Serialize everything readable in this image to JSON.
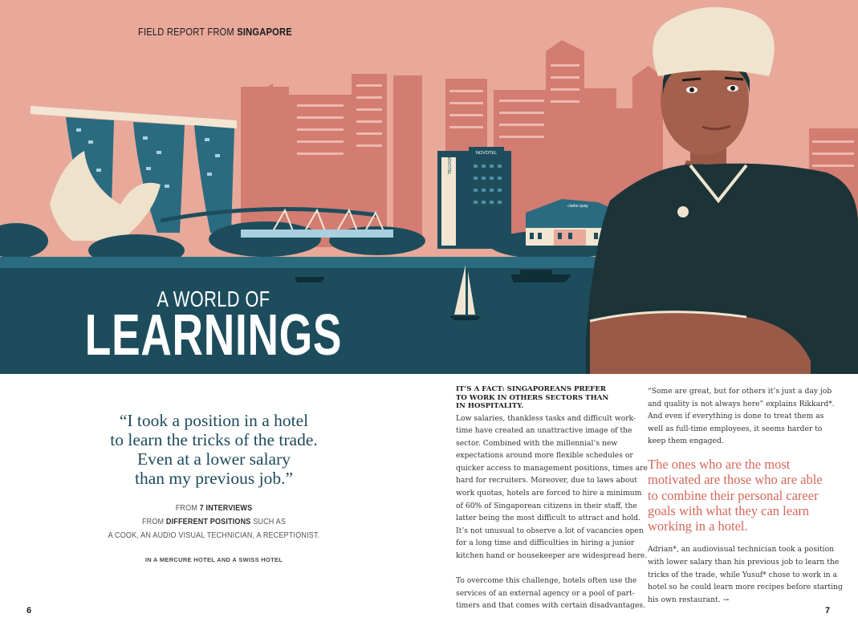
{
  "header": {
    "kicker_prefix": "FIELD REPORT FROM ",
    "kicker_city": "SINGAPORE"
  },
  "title": {
    "line1": "A WORLD OF",
    "line2": "LEARNINGS"
  },
  "illustration": {
    "signs": [
      "NOVOTEL",
      "NOVOTEL",
      "clarke quay"
    ],
    "colors": {
      "sky": "#e8a99a",
      "skyline": "#d37c72",
      "water": "#1d4d5c",
      "teal": "#2a6b80",
      "jacket": "#1c3438",
      "hat": "#efe5cf",
      "skin": "#9a5a48"
    }
  },
  "quote": {
    "lines": [
      "“I took a position in a hotel",
      "to learn the tricks of the trade.",
      "Even at a lower salary",
      "than my previous job.”"
    ]
  },
  "interviews": {
    "l1_a": "FROM ",
    "l1_b": "7 INTERVIEWS",
    "l2_a": "FROM ",
    "l2_b": "DIFFERENT POSITIONS",
    "l2_c": " SUCH AS",
    "l3": "A COOK, AN AUDIO VISUAL TECHNICIAN, A RECEPTIONIST.",
    "hotels": "IN A MERCURE HOTEL AND A SWISS HOTEL"
  },
  "article": {
    "subhead": [
      "IT’S A FACT: SINGAPOREANS PREFER",
      "TO WORK IN OTHERS SECTORS THAN",
      "IN HOSPITALITY."
    ],
    "col1_p1": [
      "Low salaries, thankless tasks and difficult work-",
      "time have created an unattractive image of the",
      "sector. Combined with the millennial’s new",
      "expectations around more flexible schedules or",
      "quicker access to management positions, times are",
      "hard for recruiters. Moreover, due to laws about",
      "work quotas, hotels are forced to hire a minimum",
      "of 60% of Singaporean citizens in their staff, the",
      "latter being the most difficult to attract and hold.",
      "It’s not unusual to observe a lot of vacancies open",
      "for a long time and difficulties in hiring a junior",
      "kitchen hand or housekeeper are widespread here."
    ],
    "col1_p2": [
      "To overcome this challenge, hotels often use the",
      "services of an external agency or a pool of part-",
      "timers and that comes with certain disadvantages."
    ],
    "col2_p1": [
      "“Some are great, but for others it’s just a day job",
      "and quality is not always here” explains Rikkard*.",
      "And even if everything is done to treat them as",
      "well as full-time employees, it seems harder to",
      "keep them engaged."
    ],
    "pull": [
      "The ones who are the most",
      "motivated are those who are able",
      "to combine their personal career",
      "goals with what they can learn",
      "working in a hotel."
    ],
    "col2_p2": [
      "Adrian*, an audiovisual technician took a position",
      "with lower salary than his previous job to learn the",
      "tricks of the trade, while Yusuf* chose to work in a",
      "hotel so he could learn more recipes before starting",
      "his own restaurant. →"
    ]
  },
  "pages": {
    "left": "6",
    "right": "7"
  }
}
